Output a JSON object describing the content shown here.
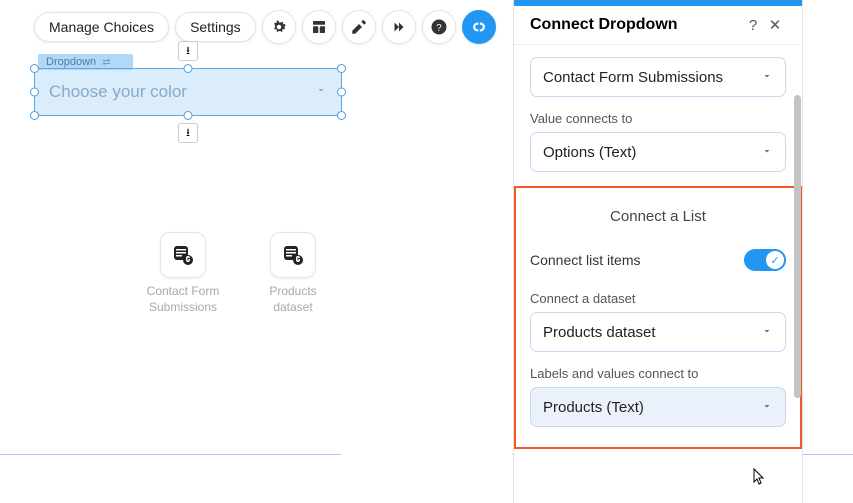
{
  "toolbar": {
    "manage_choices": "Manage Choices",
    "settings": "Settings",
    "icons": [
      "gear-icon",
      "layout-icon",
      "design-icon",
      "animate-icon",
      "help-icon",
      "connect-icon"
    ]
  },
  "canvas": {
    "element_tag": "Dropdown",
    "dropdown_placeholder": "Choose your color",
    "datasets": [
      {
        "label": "Contact Form Submissions"
      },
      {
        "label": "Products dataset"
      }
    ]
  },
  "panel": {
    "title": "Connect Dropdown",
    "dataset_select": "Contact Form Submissions",
    "value_connects_label": "Value connects to",
    "value_connects_value": "Options (Text)",
    "section_title": "Connect a List",
    "connect_list_items_label": "Connect list items",
    "connect_list_items_on": true,
    "connect_dataset_label": "Connect a dataset",
    "connect_dataset_value": "Products dataset",
    "labels_values_label": "Labels and values connect to",
    "labels_values_value": "Products (Text)"
  }
}
